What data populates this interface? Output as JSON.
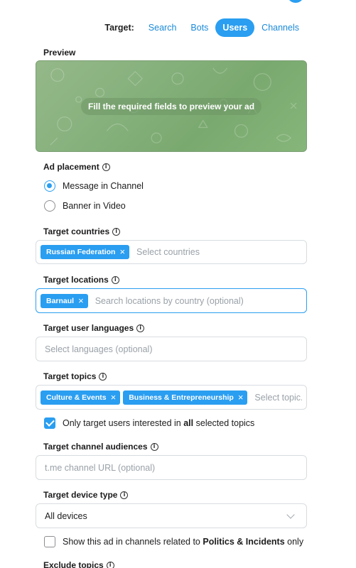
{
  "target": {
    "label": "Target:",
    "tabs": [
      {
        "label": "Search",
        "active": false
      },
      {
        "label": "Bots",
        "active": false
      },
      {
        "label": "Users",
        "active": true
      },
      {
        "label": "Channels",
        "active": false
      }
    ]
  },
  "preview": {
    "label": "Preview",
    "message": "Fill the required fields to preview your ad"
  },
  "ad_placement": {
    "label": "Ad placement",
    "options": [
      {
        "label": "Message in Channel",
        "checked": true
      },
      {
        "label": "Banner in Video",
        "checked": false
      }
    ]
  },
  "target_countries": {
    "label": "Target countries",
    "chips": [
      "Russian Federation"
    ],
    "placeholder": "Select countries"
  },
  "target_locations": {
    "label": "Target locations",
    "chips": [
      "Barnaul"
    ],
    "placeholder": "Search locations by country (optional)"
  },
  "target_languages": {
    "label": "Target user languages",
    "placeholder": "Select languages (optional)"
  },
  "target_topics": {
    "label": "Target topics",
    "chips": [
      "Culture & Events",
      "Business & Entrepreneurship"
    ],
    "placeholder": "Select topic..."
  },
  "only_interested": {
    "prefix": "Only target users interested in ",
    "bold": "all",
    "suffix": " selected topics",
    "checked": true
  },
  "channel_audiences": {
    "label": "Target channel audiences",
    "placeholder": "t.me channel URL (optional)"
  },
  "device_type": {
    "label": "Target device type",
    "value": "All devices"
  },
  "politics": {
    "prefix": "Show this ad in channels related to ",
    "bold": "Politics & Incidents",
    "suffix": " only",
    "checked": false
  },
  "exclude_topics": {
    "label": "Exclude topics"
  },
  "icons": {
    "info": "i",
    "chip_remove": "×"
  },
  "colors": {
    "accent": "#2a9ef1",
    "preview_bg": "#86b17d"
  }
}
